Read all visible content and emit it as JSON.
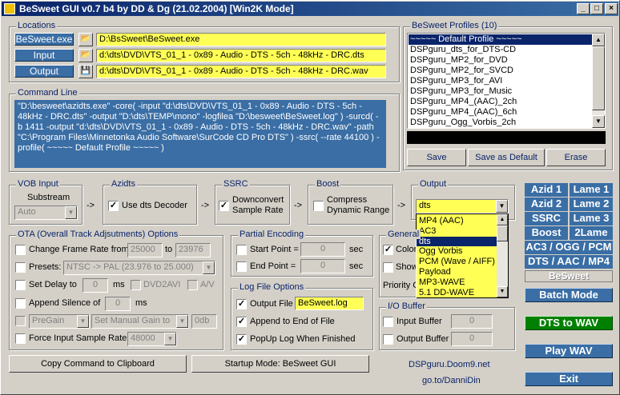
{
  "window": {
    "title": "BeSweet GUI v0.7 b4 by DD & Dg (21.02.2004)   [Win2K Mode]",
    "minimize": "_",
    "maximize": "□",
    "close": "×"
  },
  "locations": {
    "label": "Locations",
    "rows": [
      {
        "button": "BeSweet.exe",
        "value": "D:\\BsSweet\\BeSweet.exe"
      },
      {
        "button": "Input",
        "value": "d:\\dts\\DVD\\VTS_01_1 - 0x89 - Audio - DTS - 5ch - 48kHz - DRC.dts"
      },
      {
        "button": "Output",
        "value": "d:\\dts\\DVD\\VTS_01_1 - 0x89 - Audio - DTS - 5ch - 48kHz - DRC.wav"
      }
    ]
  },
  "profiles": {
    "label": "BeSweet Profiles (10)",
    "items": [
      "~~~~~ Default Profile ~~~~~",
      "DSPguru_dts_for_DTS-CD",
      "DSPguru_MP2_for_DVD",
      "DSPguru_MP2_for_SVCD",
      "DSPguru_MP3_for_AVI",
      "DSPguru_MP3_for_Music",
      "DSPguru_MP4_(AAC)_2ch",
      "DSPguru_MP4_(AAC)_6ch",
      "DSPguru_Ogg_Vorbis_2ch"
    ],
    "selected_index": 0,
    "save": "Save",
    "save_default": "Save as Default",
    "erase": "Erase"
  },
  "command_line": {
    "label": "Command Line",
    "text": "\"D:\\besweet\\azidts.exe\" -core( -input \"d:\\dts\\DVD\\VTS_01_1 - 0x89 - Audio - DTS - 5ch - 48kHz - DRC.dts\" -output \"D:\\dts\\TEMP\\mono\" -logfilea \"D:\\besweet\\BeSweet.log\" ) -surcd( -b 1411 -output \"d:\\dts\\DVD\\VTS_01_1 - 0x89 - Audio - DTS - 5ch - 48kHz - DRC.wav\" -path \"C:\\Program Files\\Minnetonka Audio Software\\SurCode CD Pro DTS\" ) -ssrc( --rate 44100 ) -profile( ~~~~~ Default Profile ~~~~~ )"
  },
  "vob": {
    "label": "VOB Input",
    "substream": "Substream",
    "value": "Auto"
  },
  "azidts": {
    "label": "Azidts",
    "check": "Use dts Decoder"
  },
  "ssrc": {
    "label": "SSRC",
    "check1": "Downconvert",
    "check2": "Sample Rate"
  },
  "boost": {
    "label": "Boost",
    "check1": "Compress",
    "check2": "Dynamic Range"
  },
  "output": {
    "label": "Output",
    "value": "dts",
    "options": [
      "MP4 (AAC)",
      "AC3",
      "dts",
      "Ogg Vorbis",
      "PCM (Wave / AIFF)",
      "Payload",
      "MP3-WAVE",
      "5.1 DD-WAVE"
    ],
    "selected_index": 2
  },
  "arrows": [
    "->",
    "->",
    "->",
    "->"
  ],
  "right_panel": {
    "rows": [
      [
        "Azid 1",
        "Lame 1"
      ],
      [
        "Azid 2",
        "Lame 2"
      ],
      [
        "SSRC",
        "Lame 3"
      ],
      [
        "Boost",
        "2Lame"
      ]
    ],
    "wide": [
      "AC3 / OGG / PCM",
      "DTS / AAC / MP4"
    ],
    "besweet": "BeSweet",
    "batch": "Batch Mode",
    "dts_wav": "DTS to WAV",
    "play": "Play WAV",
    "exit": "Exit",
    "link1": "DSPguru.Doom9.net",
    "link2": "go.to/DanniDin"
  },
  "ota": {
    "label": "OTA (Overall Track Adjsutments) Options",
    "frame_rate": "Change Frame Rate from",
    "from": "25000",
    "to_label": "to",
    "to": "23976",
    "presets": "Presets:",
    "preset_value": "NTSC -> PAL    (23.976 to 25.000)",
    "delay": "Set Delay to",
    "delay_value": "0",
    "ms": "ms",
    "dvd2avi": "DVD2AVI",
    "av": "A/V",
    "silence": "Append Silence of",
    "silence_value": "0",
    "ms2": "ms",
    "pregain": "PreGain",
    "gain_mode": "Set Manual Gain to",
    "gain_value": "0db",
    "force_rate": "Force Input Sample Rate",
    "rate_value": "48000"
  },
  "partial": {
    "label": "Partial Encoding",
    "start": "Start Point =",
    "start_value": "0",
    "end": "End Point =",
    "end_value": "0",
    "sec1": "sec",
    "sec2": "sec"
  },
  "general": {
    "label": "General",
    "colors": "Colors",
    "show": "Show",
    "priority": "Priority C"
  },
  "logfile": {
    "label": "Log File Options",
    "output_file": "Output File",
    "output_value": "BeSweet.log",
    "append": "Append to End of File",
    "popup": "PopUp Log When Finished"
  },
  "io": {
    "label": "I/O Buffer",
    "input": "Input Buffer",
    "input_value": "0",
    "output": "Output Buffer",
    "output_value": "0"
  },
  "bottom": {
    "copy": "Copy Command to Clipboard",
    "startup": "Startup Mode: BeSweet GUI"
  }
}
